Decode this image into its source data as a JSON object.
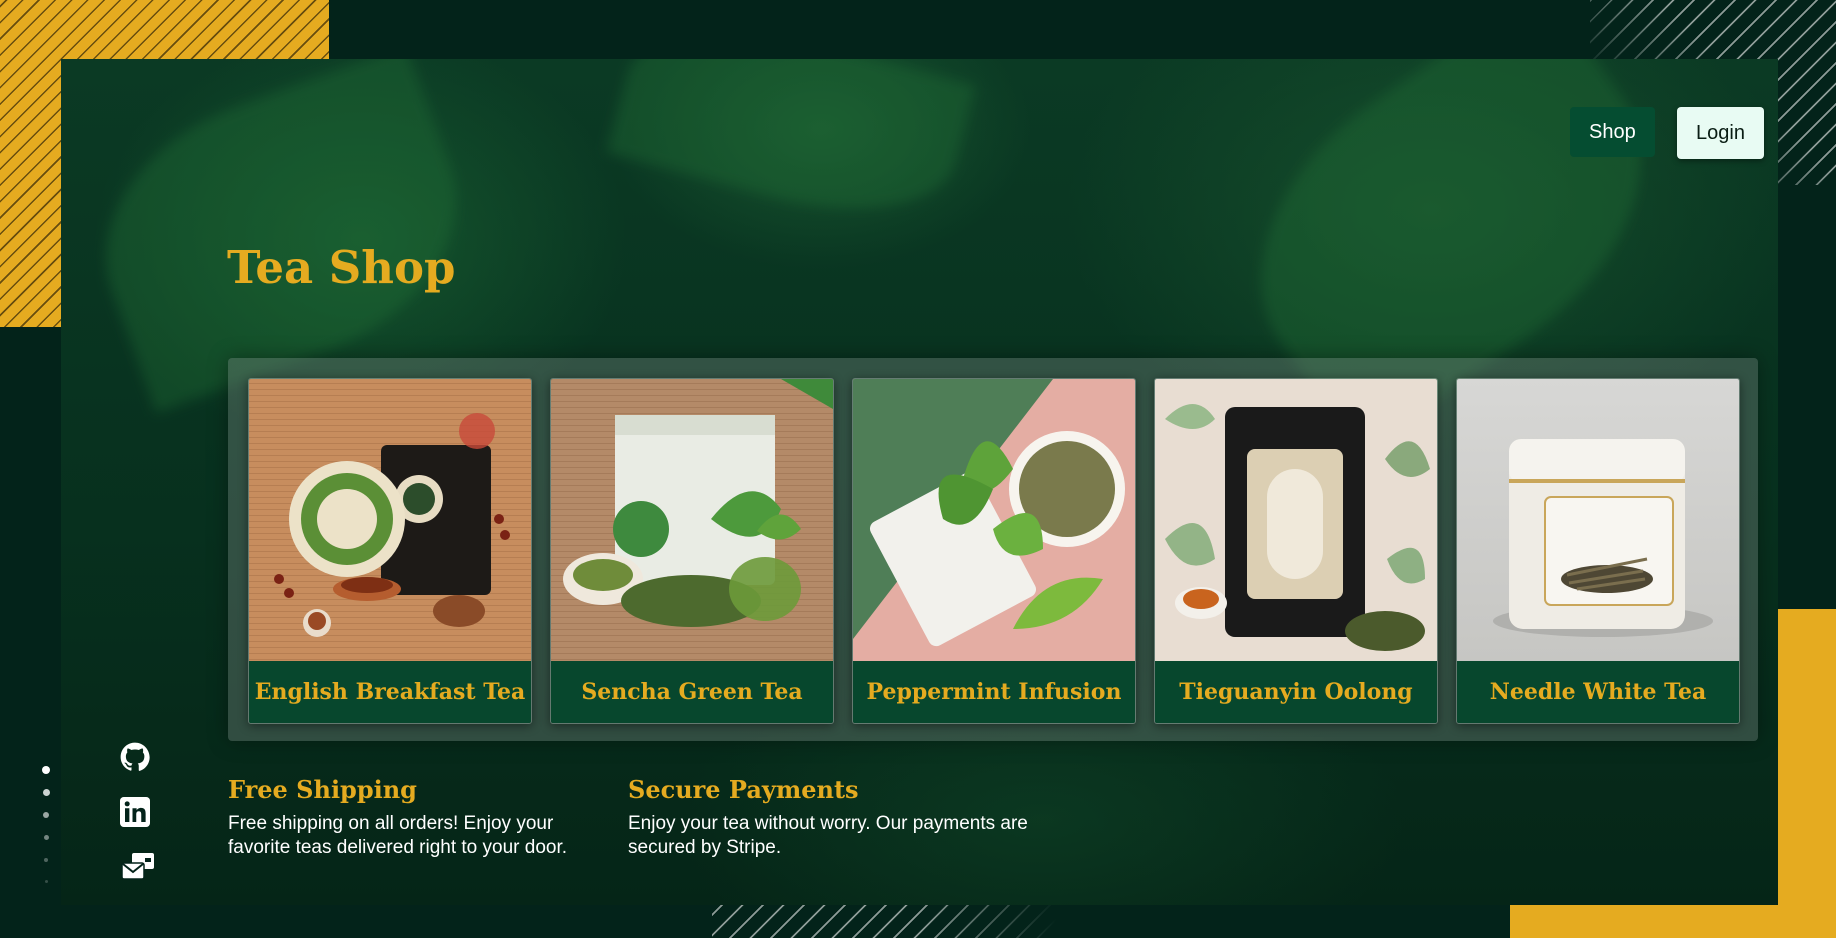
{
  "nav": {
    "shop_label": "Shop",
    "login_label": "Login"
  },
  "hero": {
    "title": "Tea Shop"
  },
  "products": [
    {
      "name": "English Breakfast Tea"
    },
    {
      "name": "Sencha Green Tea"
    },
    {
      "name": "Peppermint Infusion"
    },
    {
      "name": "Tieguanyin Oolong"
    },
    {
      "name": "Needle White Tea"
    }
  ],
  "features": [
    {
      "title": "Free Shipping",
      "text": "Free shipping on all orders! Enjoy your favorite teas delivered right to your door."
    },
    {
      "title": "Secure Payments",
      "text": "Enjoy your tea without worry. Our payments are secured by Stripe."
    }
  ],
  "social": [
    "github-icon",
    "linkedin-icon",
    "contact-icon"
  ],
  "colors": {
    "accent": "#e5ab20",
    "dark": "#03231a",
    "card_label_bg": "#07472d",
    "shop_button": "#054d31"
  }
}
